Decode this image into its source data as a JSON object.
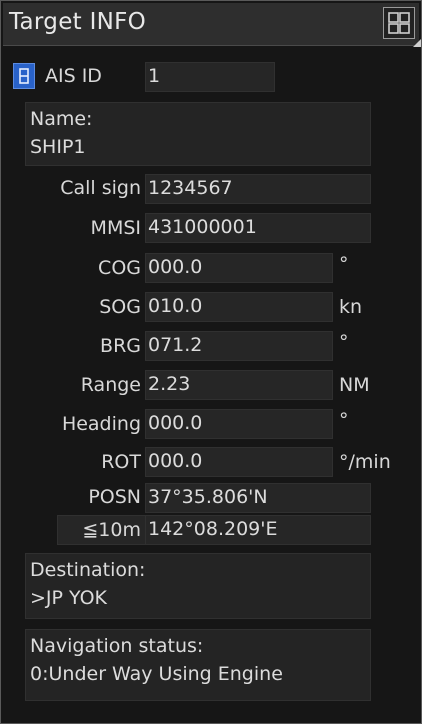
{
  "window": {
    "title": "Target INFO"
  },
  "ais": {
    "label": "AIS ID",
    "value": "1"
  },
  "name": {
    "label": "Name:",
    "value": "SHIP1"
  },
  "call_sign": {
    "label": "Call sign",
    "value": "1234567"
  },
  "mmsi": {
    "label": "MMSI",
    "value": "431000001"
  },
  "cog": {
    "label": "COG",
    "value": "000.0",
    "unit": "°"
  },
  "sog": {
    "label": "SOG",
    "value": "010.0",
    "unit": "kn"
  },
  "brg": {
    "label": "BRG",
    "value": "071.2",
    "unit": "°"
  },
  "range": {
    "label": "Range",
    "value": "2.23",
    "unit": "NM"
  },
  "heading": {
    "label": "Heading",
    "value": "000.0",
    "unit": "°"
  },
  "rot": {
    "label": "ROT",
    "value": "000.0",
    "unit": "°/min"
  },
  "posn": {
    "label": "POSN",
    "lat": "37°35.806'N",
    "accuracy": "≦10m",
    "lon": "142°08.209'E"
  },
  "destination": {
    "label": "Destination:",
    "value": ">JP YOK"
  },
  "nav_status": {
    "label": "Navigation status:",
    "value": "0:Under Way Using Engine"
  },
  "colors": {
    "background": "#161616",
    "field": "#262626",
    "accent": "#2962c9",
    "text": "#dcdcdc"
  },
  "icons": {
    "menu": "grid-menu-icon",
    "ais_toggle": "ais-toggle-icon"
  }
}
